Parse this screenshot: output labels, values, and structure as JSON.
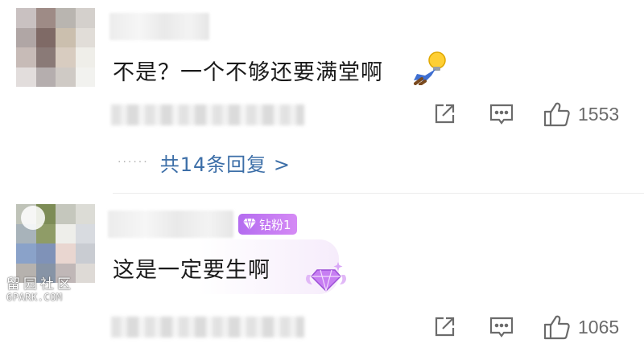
{
  "comments": [
    {
      "text": "不是？一个不够还要满堂啊",
      "emoji_icon": "stickman-lightbulb-icon",
      "actions": {
        "share_icon": "share-icon",
        "reply_icon": "comment-icon",
        "like_icon": "thumbs-up-icon",
        "likes": "1553"
      },
      "replies_label": "共14条回复 >",
      "replies_dots": "······"
    },
    {
      "text": "这是一定要生啊",
      "badge": {
        "icon": "diamond-icon",
        "label": "钻粉1",
        "color": "#c17cf3"
      },
      "actions": {
        "share_icon": "share-icon",
        "reply_icon": "comment-icon",
        "like_icon": "thumbs-up-icon",
        "likes": "1065"
      }
    }
  ],
  "watermark": {
    "cn": "留园社区",
    "en": "6PARK.COM"
  },
  "colors": {
    "link": "#3d6fa8",
    "icon": "#6b6b6b",
    "badge": "#c17cf3"
  }
}
